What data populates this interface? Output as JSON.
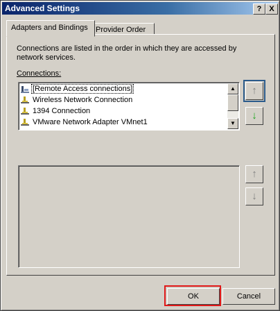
{
  "window": {
    "title": "Advanced Settings"
  },
  "titlebar_buttons": {
    "help": "?",
    "close": "X"
  },
  "tabs": [
    {
      "label": "Adapters and Bindings"
    },
    {
      "label": "Provider Order"
    }
  ],
  "panel": {
    "description": "Connections are listed in the order in which they are accessed by network services.",
    "connections_label": "Connections:",
    "connections": [
      {
        "name": "[Remote Access connections]",
        "icon": "remote-access-icon"
      },
      {
        "name": "Wireless Network Connection",
        "icon": "network-connection-icon"
      },
      {
        "name": "1394 Connection",
        "icon": "network-connection-icon"
      },
      {
        "name": "VMware Network Adapter VMnet1",
        "icon": "network-connection-icon"
      }
    ],
    "move_up_glyph": "↑",
    "move_down_glyph": "↓",
    "bind_up_glyph": "↑",
    "bind_down_glyph": "↓"
  },
  "buttons": {
    "ok": "OK",
    "cancel": "Cancel"
  },
  "colors": {
    "titlebar": "#0a246a",
    "highlight": "#e01818",
    "green_arrow": "#1aa31a"
  }
}
